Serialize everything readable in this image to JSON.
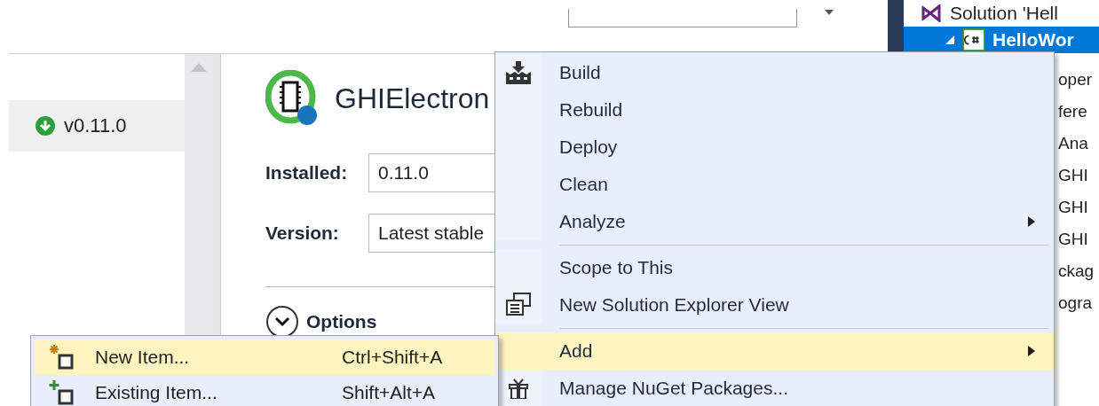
{
  "package_list": {
    "items": [
      {
        "version": "v0.11.0",
        "selected": true
      }
    ]
  },
  "package_detail": {
    "title": "GHIElectron",
    "installed_label": "Installed:",
    "installed_value": "0.11.0",
    "version_label": "Version:",
    "version_value": "Latest stable",
    "options_label": "Options"
  },
  "solution_explorer": {
    "items": [
      {
        "label": "Solution 'Hell",
        "kind": "solution",
        "selected": false,
        "children": [
          {
            "label": "HelloWor",
            "kind": "project",
            "selected": true,
            "children": [
              {
                "label": "oper",
                "kind": "node",
                "selected": false
              },
              {
                "label": "fere",
                "kind": "node",
                "selected": false
              },
              {
                "label": "Ana",
                "kind": "node",
                "selected": false
              },
              {
                "label": "GHI",
                "kind": "node",
                "selected": false
              },
              {
                "label": "GHI",
                "kind": "node",
                "selected": false
              },
              {
                "label": "GHI",
                "kind": "node",
                "selected": false
              },
              {
                "label": "ckag",
                "kind": "node",
                "selected": false
              },
              {
                "label": "ogra",
                "kind": "node",
                "selected": false
              }
            ]
          }
        ]
      }
    ]
  },
  "context_menu": {
    "items": [
      {
        "kind": "item",
        "label": "Build",
        "selected": false,
        "has_submenu": false
      },
      {
        "kind": "item",
        "label": "Rebuild",
        "selected": false,
        "has_submenu": false
      },
      {
        "kind": "item",
        "label": "Deploy",
        "selected": false,
        "has_submenu": false
      },
      {
        "kind": "item",
        "label": "Clean",
        "selected": false,
        "has_submenu": false
      },
      {
        "kind": "item",
        "label": "Analyze",
        "selected": false,
        "has_submenu": true
      },
      {
        "kind": "separator"
      },
      {
        "kind": "item",
        "label": "Scope to This",
        "selected": false,
        "has_submenu": false
      },
      {
        "kind": "item",
        "label": "New Solution Explorer View",
        "selected": false,
        "has_submenu": false
      },
      {
        "kind": "separator"
      },
      {
        "kind": "item",
        "label": "Add",
        "selected": true,
        "has_submenu": true
      },
      {
        "kind": "item",
        "label": "Manage NuGet Packages...",
        "selected": false,
        "has_submenu": false
      }
    ]
  },
  "add_submenu": {
    "items": [
      {
        "label": "New Item...",
        "shortcut": "Ctrl+Shift+A",
        "selected": true
      },
      {
        "label": "Existing Item...",
        "shortcut": "Shift+Alt+A",
        "selected": false
      }
    ]
  }
}
